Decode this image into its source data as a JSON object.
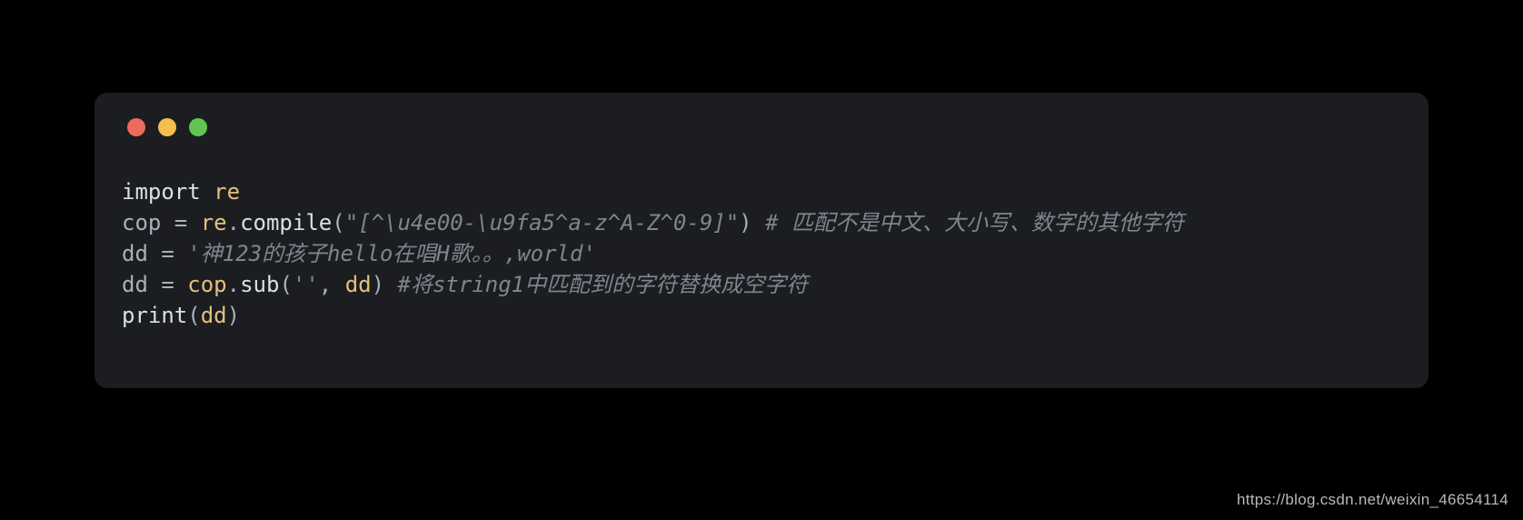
{
  "code": {
    "line1": {
      "kw": "import",
      "mod": "re"
    },
    "line2": {
      "lhs": "cop",
      "eq": " = ",
      "obj": "re",
      "dot": ".",
      "fn": "compile",
      "open": "(",
      "arg": "\"[^\\u4e00-\\u9fa5^a-z^A-Z^0-9]\"",
      "close": ")",
      "sp": " ",
      "comment": "# 匹配不是中文、大小写、数字的其他字符"
    },
    "line3": {
      "lhs": "dd",
      "eq": " = ",
      "str": "'神123的孩子hello在唱H歌。。,world'"
    },
    "line4": {
      "lhs": "dd",
      "eq": " = ",
      "obj": "cop",
      "dot": ".",
      "fn": "sub",
      "open": "(",
      "a1": "''",
      "comma": ", ",
      "a2": "dd",
      "close": ")",
      "sp": " ",
      "comment": "#将string1中匹配到的字符替换成空字符"
    },
    "line5": {
      "fn": "print",
      "open": "(",
      "arg": "dd",
      "close": ")"
    }
  },
  "watermark": "https://blog.csdn.net/weixin_46654114"
}
